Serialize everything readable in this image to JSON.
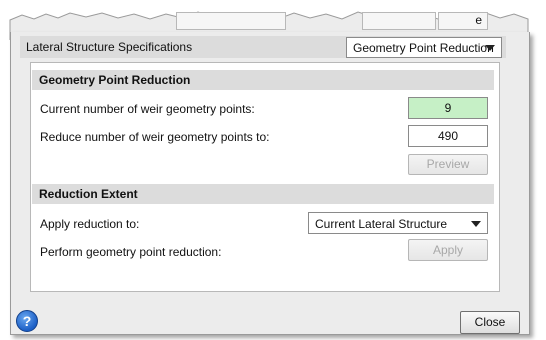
{
  "section": {
    "title": "Lateral Structure Specifications",
    "mode_select": "Geometry Point Reduction"
  },
  "geometry": {
    "title": "Geometry Point Reduction",
    "current_label": "Current number of weir geometry points:",
    "current_value": "9",
    "reduce_label": "Reduce number of weir geometry points to:",
    "reduce_value": "490",
    "preview_label": "Preview"
  },
  "extent": {
    "title": "Reduction Extent",
    "apply_to_label": "Apply reduction to:",
    "apply_to_value": "Current Lateral Structure",
    "perform_label": "Perform geometry point reduction:",
    "apply_label": "Apply"
  },
  "footer": {
    "help_glyph": "?",
    "close_label": "Close",
    "partial_top_text": "e"
  },
  "colors": {
    "current_value_bg": "#c6f0c6",
    "help_icon": "#1c5fc6"
  }
}
